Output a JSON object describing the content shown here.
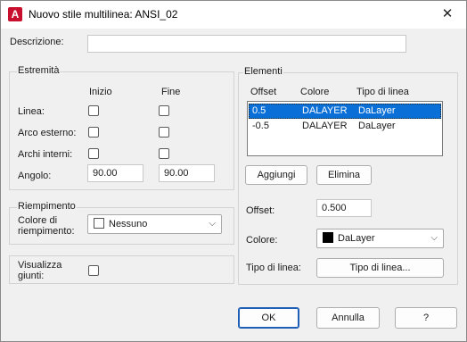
{
  "window": {
    "title": "Nuovo stile multilinea: ANSI_02",
    "close_glyph": "✕"
  },
  "description": {
    "label": "Descrizione:",
    "value": ""
  },
  "extremities": {
    "title": "Estremità",
    "col_start": "Inizio",
    "col_end": "Fine",
    "line_label": "Linea:",
    "outer_arc_label": "Arco esterno:",
    "inner_arcs_label": "Archi interni:",
    "angle_label": "Angolo:",
    "angle_start": "90.00",
    "angle_end": "90.00"
  },
  "fill": {
    "title": "Riempimento",
    "color_label_1": "Colore di",
    "color_label_2": "riempimento:",
    "color_value": "Nessuno"
  },
  "show_joints": {
    "label_1": "Visualizza",
    "label_2": "giunti:"
  },
  "elements": {
    "title": "Elementi",
    "headers": {
      "offset": "Offset",
      "color": "Colore",
      "linetype": "Tipo di linea"
    },
    "rows": [
      {
        "offset": "0.5",
        "color": "DALAYER",
        "linetype": "DaLayer"
      },
      {
        "offset": "-0.5",
        "color": "DALAYER",
        "linetype": "DaLayer"
      }
    ],
    "add_button": "Aggiungi",
    "delete_button": "Elimina",
    "offset_label": "Offset:",
    "offset_value": "0.500",
    "color_label": "Colore:",
    "color_value": "DaLayer",
    "linetype_label": "Tipo di linea:",
    "linetype_button": "Tipo di linea..."
  },
  "footer": {
    "ok": "OK",
    "cancel": "Annulla",
    "help": "?"
  },
  "colors": {
    "accent": "#0a6fd6",
    "autocad_red": "#c8102e"
  }
}
